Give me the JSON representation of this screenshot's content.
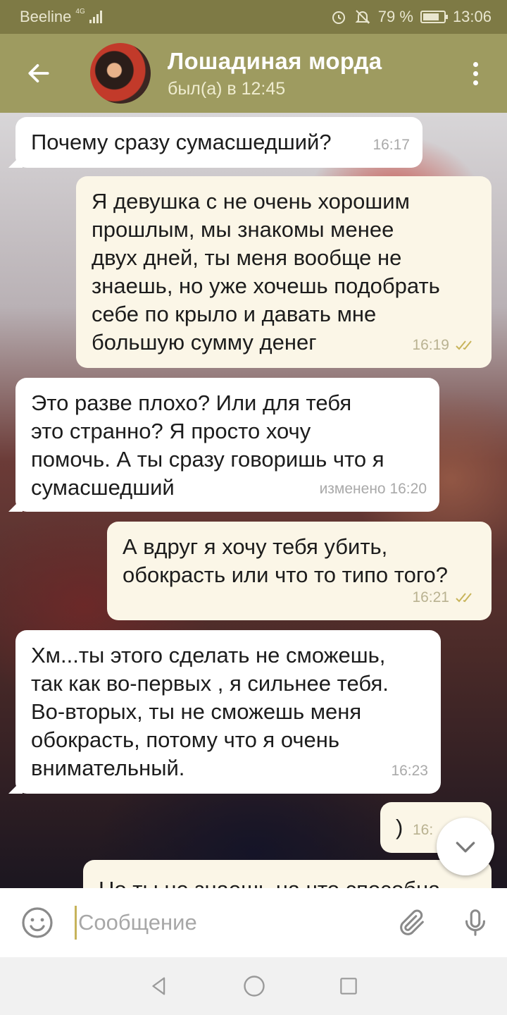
{
  "status_bar": {
    "carrier": "Beeline",
    "network": "4G",
    "battery": "79 %",
    "battery_level": 0.79,
    "time": "13:06"
  },
  "header": {
    "contact_name": "Лошадиная морда",
    "last_seen": "был(а) в 12:45"
  },
  "messages": [
    {
      "direction": "in",
      "text": "Почему сразу сумасшедший?",
      "time": "16:17"
    },
    {
      "direction": "out",
      "text": "Я девушка с не очень хорошим\nпрошлым, мы знакомы менее\nдвух дней, ты меня вообще не\nзнаешь, но уже хочешь подобрать\nсебе по крыло и давать мне\nбольшую сумму денег",
      "time": "16:19",
      "read": true
    },
    {
      "direction": "in",
      "text": "Это разве плохо? Или для тебя\nэто странно? Я просто хочу\nпомочь. А ты сразу говоришь что я\nсумасшедший",
      "time": "изменено 16:20"
    },
    {
      "direction": "out",
      "text": "А вдруг я хочу тебя убить,\nобокрасть или что то типо того?",
      "time": "16:21",
      "read": true
    },
    {
      "direction": "in",
      "text": "Хм...ты этого сделать не сможешь,\nтак как во-первых , я сильнее тебя.\nВо-вторых, ты не сможешь меня\nобокрасть, потому что я очень\nвнимательный.",
      "time": "16:23"
    },
    {
      "direction": "out",
      "text": ")",
      "time": "16:"
    },
    {
      "direction": "out",
      "text": "Но ты не знаешь на что способна",
      "time": ""
    }
  ],
  "input": {
    "placeholder": "Сообщение"
  },
  "colors": {
    "header": "#9e9b60",
    "status_bar": "#7e7a45",
    "outgoing_bubble": "#fbf6e7",
    "incoming_bubble": "#ffffff",
    "read_ticks": "#c8b45a"
  },
  "icons": {
    "back": "arrow-left-icon",
    "menu": "more-vertical-icon",
    "emoji": "smile-icon",
    "attach": "paperclip-icon",
    "mic": "microphone-icon",
    "scroll": "chevron-down-icon"
  }
}
